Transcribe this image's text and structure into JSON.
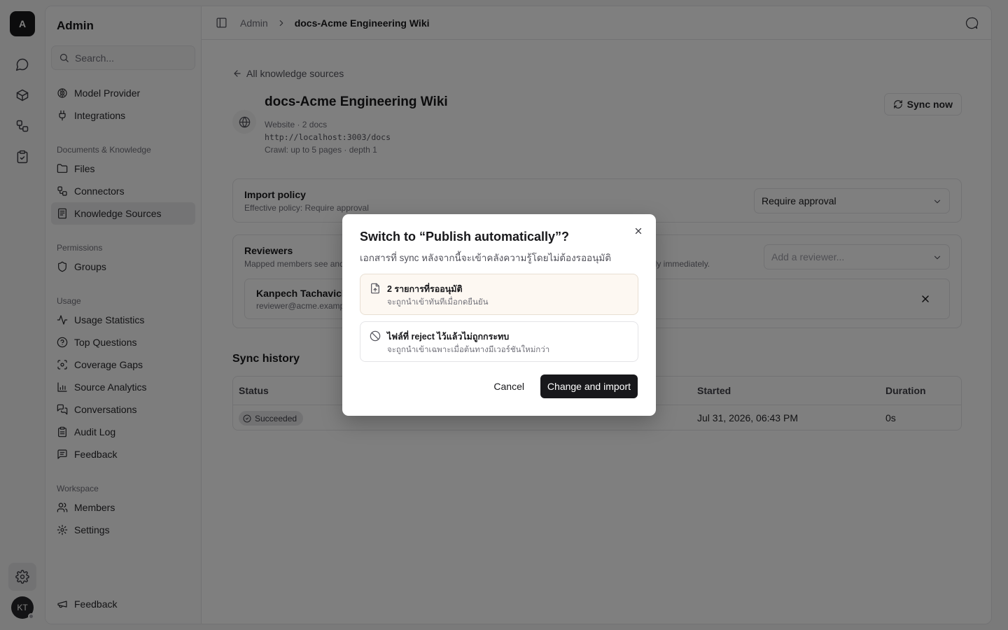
{
  "rail": {
    "logo": "A",
    "avatar": "KT"
  },
  "sidebar": {
    "title": "Admin",
    "search_placeholder": "Search...",
    "top_items": [
      {
        "label": "Model Provider",
        "icon": "brain-icon"
      },
      {
        "label": "Integrations",
        "icon": "plug-icon"
      }
    ],
    "groups": [
      {
        "label": "Documents & Knowledge",
        "items": [
          {
            "label": "Files",
            "icon": "folder-icon"
          },
          {
            "label": "Connectors",
            "icon": "workflow-icon"
          },
          {
            "label": "Knowledge Sources",
            "icon": "notebook-icon"
          }
        ]
      },
      {
        "label": "Permissions",
        "items": [
          {
            "label": "Groups",
            "icon": "shield-icon"
          }
        ]
      },
      {
        "label": "Usage",
        "items": [
          {
            "label": "Usage Statistics",
            "icon": "activity-icon"
          },
          {
            "label": "Top Questions",
            "icon": "help-circle-icon"
          },
          {
            "label": "Coverage Gaps",
            "icon": "scan-icon"
          },
          {
            "label": "Source Analytics",
            "icon": "bar-chart-icon"
          },
          {
            "label": "Conversations",
            "icon": "messages-icon"
          },
          {
            "label": "Audit Log",
            "icon": "clipboard-icon"
          },
          {
            "label": "Feedback",
            "icon": "message-square-text-icon"
          }
        ]
      },
      {
        "label": "Workspace",
        "items": [
          {
            "label": "Members",
            "icon": "users-icon"
          },
          {
            "label": "Settings",
            "icon": "gear-icon"
          }
        ]
      }
    ],
    "footer": "Feedback"
  },
  "topbar": {
    "crumb_root": "Admin",
    "crumb_current": "docs-Acme Engineering Wiki"
  },
  "source": {
    "back_label": "All knowledge sources",
    "title": "docs-Acme Engineering Wiki",
    "meta": "Website · 2 docs",
    "url": "http://localhost:3003/docs",
    "crawl": "Crawl: up to 5 pages · depth 1",
    "sync_label": "Sync now"
  },
  "import_policy": {
    "heading": "Import policy",
    "sub": "Effective policy: Require approval",
    "selected": "Require approval"
  },
  "reviewers": {
    "heading": "Reviewers",
    "sub_left": "Mapped members see and",
    "sub_right": "ply immediately.",
    "placeholder": "Add a reviewer...",
    "rows": [
      {
        "name": "Kanpech Tachavichi",
        "email": "reviewer@acme.examp"
      }
    ]
  },
  "history": {
    "title": "Sync history",
    "columns": {
      "status": "Status",
      "started": "Started",
      "duration": "Duration"
    },
    "rows": [
      {
        "status": "Succeeded",
        "started": "Jul 31, 2026, 06:43 PM",
        "duration": "0s"
      }
    ]
  },
  "dialog": {
    "title": "Switch to “Publish automatically”?",
    "description": "เอกสารที่ sync หลังจากนี้จะเข้าคลังความรู้โดยไม่ต้องรออนุมัติ",
    "options": [
      {
        "title": "2 รายการที่รออนุมัติ",
        "subtitle": "จะถูกนำเข้าทันทีเมื่อกดยืนยัน",
        "icon": "file-up-icon"
      },
      {
        "title": "ไฟล์ที่ reject ไว้แล้วไม่ถูกกระทบ",
        "subtitle": "จะถูกนำเข้าเฉพาะเมื่อต้นทางมีเวอร์ชันใหม่กว่า",
        "icon": "ban-icon"
      }
    ],
    "cancel": "Cancel",
    "confirm": "Change and import"
  }
}
